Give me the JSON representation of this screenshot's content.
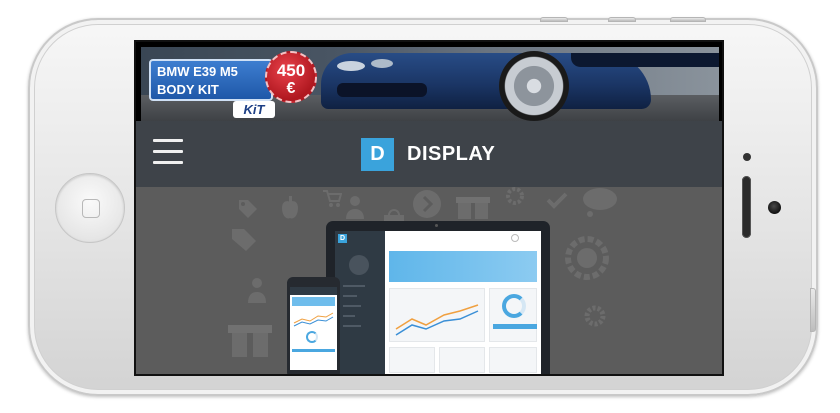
{
  "ad": {
    "title_line1": "BMW E39 M5",
    "title_line2": "BODY KIT",
    "price": "450",
    "currency": "€",
    "brand": "KiT"
  },
  "header": {
    "logo_letter": "D",
    "logo_text": "DISPLAY"
  },
  "hero": {
    "dashboard_brand": "D",
    "background_icons": [
      "tag-icon",
      "apple-icon",
      "cart-icon",
      "shopping-bag-icon",
      "arrow-right-icon",
      "gift-icon",
      "gear-icon",
      "check-icon",
      "chat-bubble-icon",
      "tags-icon",
      "badge-icon",
      "user-icon"
    ]
  },
  "colors": {
    "header_bg": "#3e4349",
    "hero_bg": "#5c5c5c",
    "accent": "#3aa3dc",
    "chart_line_blue": "#3a8fd6",
    "chart_line_orange": "#f0a040"
  }
}
